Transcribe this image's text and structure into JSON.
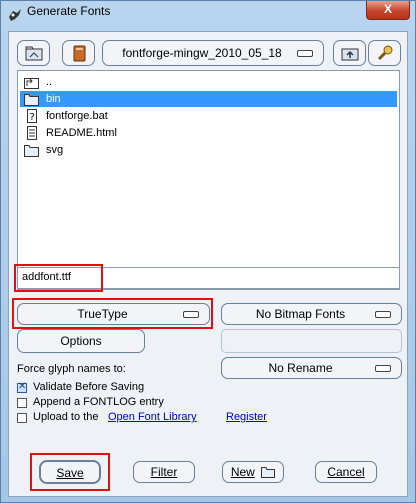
{
  "window": {
    "title": "Generate Fonts",
    "close_label": "X"
  },
  "toolbar": {
    "directory": "fontforge-mingw_2010_05_18"
  },
  "files": [
    {
      "name": "..",
      "icon": "up-folder-icon"
    },
    {
      "name": "bin",
      "icon": "folder-icon",
      "selected": true
    },
    {
      "name": "fontforge.bat",
      "icon": "unknown-file-icon"
    },
    {
      "name": "README.html",
      "icon": "document-icon"
    },
    {
      "name": "svg",
      "icon": "folder-icon"
    }
  ],
  "filename": "addfont.ttf",
  "format": {
    "outline": "TrueType",
    "bitmap": "No Bitmap Fonts"
  },
  "options_label": "Options",
  "force_names": {
    "label": "Force glyph names to:",
    "value": "No Rename"
  },
  "checks": {
    "validate": {
      "label": "Validate Before Saving",
      "checked": true
    },
    "fontlog": {
      "label": "Append a FONTLOG entry",
      "checked": false
    },
    "upload": {
      "label": "Upload to the",
      "checked": false
    }
  },
  "links": {
    "ofl": "Open Font Library",
    "register": "Register"
  },
  "buttons": {
    "save": "Save",
    "filter": "Filter",
    "new": "New",
    "cancel": "Cancel"
  },
  "colors": {
    "selection": "#3399ff",
    "highlight_box": "#e01010",
    "link": "#0000cc"
  }
}
